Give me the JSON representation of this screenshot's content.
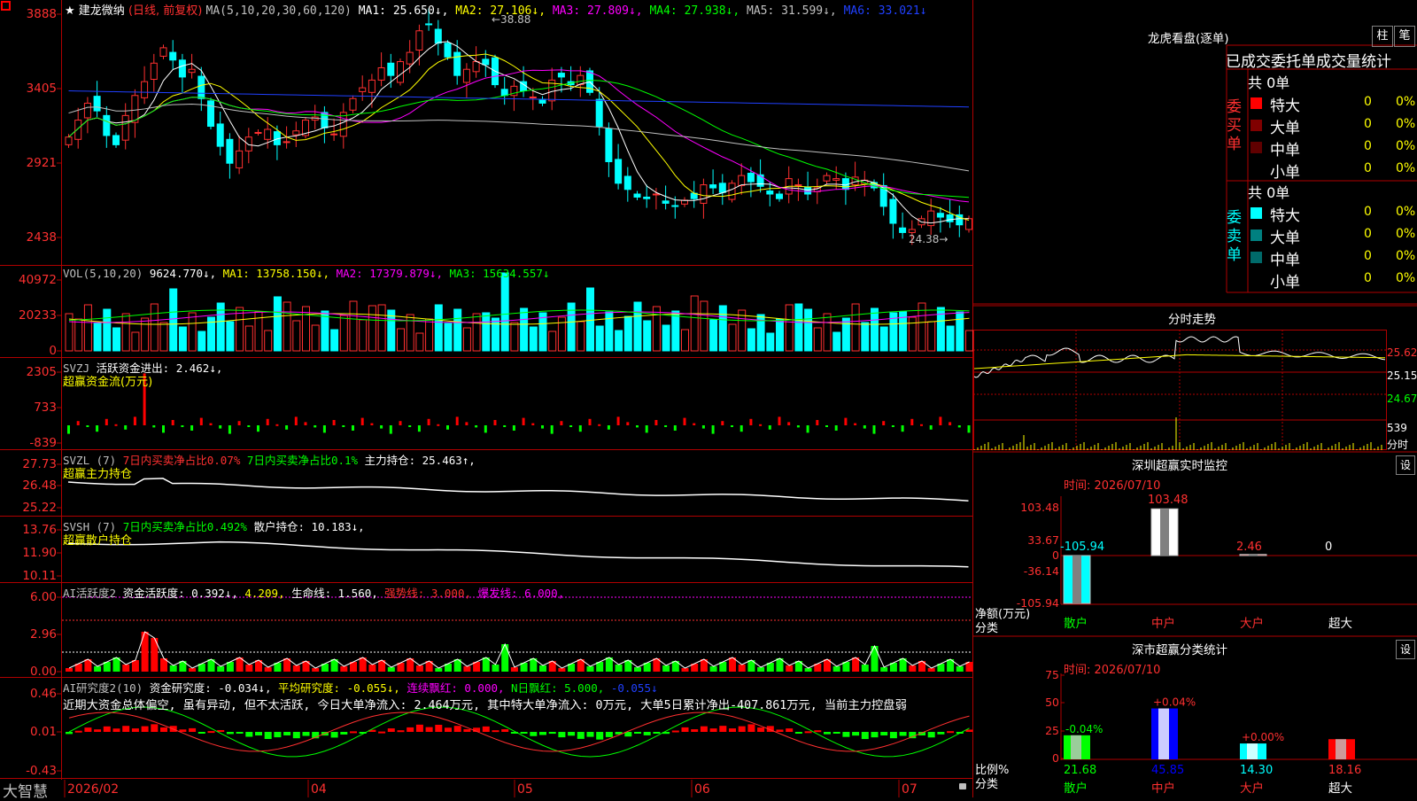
{
  "stock": {
    "name": "建龙微纳",
    "mode": "(日线, 前复权)",
    "ma_line": [
      {
        "t": "MA(5,10,20,30,60,120)",
        "c": "#c0c0c0"
      },
      {
        "t": "MA1: 25.650↓,",
        "c": "#ffffff"
      },
      {
        "t": "MA2: 27.106↓,",
        "c": "#ffff00"
      },
      {
        "t": "MA3: 27.809↓,",
        "c": "#ff00ff"
      },
      {
        "t": "MA4: 27.938↓,",
        "c": "#00ff00"
      },
      {
        "t": "MA5: 31.599↓,",
        "c": "#c0c0c0"
      },
      {
        "t": "MA6: 33.021↓",
        "c": "#2040ff"
      }
    ],
    "price_axis": [
      "3888",
      "3405",
      "2921",
      "2438"
    ],
    "high_label": "38.88",
    "low_label": "24.38"
  },
  "panels": {
    "vol": {
      "axis": [
        "40972",
        "20233",
        "0"
      ],
      "legend": [
        {
          "t": "VOL(5,10,20)",
          "c": "#c0c0c0"
        },
        {
          "t": "9624.770↓,",
          "c": "#ffffff"
        },
        {
          "t": "MA1: 13758.150↓,",
          "c": "#ffff00"
        },
        {
          "t": "MA2: 17379.879↓,",
          "c": "#ff00ff"
        },
        {
          "t": "MA3: 15634.557↓",
          "c": "#00ff00"
        }
      ]
    },
    "svzj": {
      "axis": [
        "2305",
        "733",
        "-839"
      ],
      "legend": [
        {
          "t": "SVZJ",
          "c": "#c0c0c0"
        },
        {
          "t": "活跃资金进出: 2.462↓,",
          "c": "#ffffff"
        }
      ],
      "sub": "超赢资金流(万元)"
    },
    "svzl": {
      "axis": [
        "27.73",
        "26.48",
        "25.22"
      ],
      "legend": [
        {
          "t": "SVZL (7)",
          "c": "#c0c0c0"
        },
        {
          "t": "7日内买卖净占比0.07%",
          "c": "#ff3030"
        },
        {
          "t": "7日内买卖净占比0.1%",
          "c": "#00ff00"
        },
        {
          "t": "主力持仓: 25.463↑,",
          "c": "#ffffff"
        }
      ],
      "sub": "超赢主力持仓"
    },
    "svsh": {
      "axis": [
        "13.76",
        "11.90",
        "10.11"
      ],
      "legend": [
        {
          "t": "SVSH (7)",
          "c": "#c0c0c0"
        },
        {
          "t": "7日内买卖净占比0.492%",
          "c": "#00ff00"
        },
        {
          "t": "散户持仓: 10.183↓,",
          "c": "#ffffff"
        }
      ],
      "sub": "超赢散户持仓"
    },
    "ai1": {
      "axis": [
        "6.00",
        "2.96",
        "0.00"
      ],
      "legend": [
        {
          "t": "AI活跃度2",
          "c": "#c0c0c0"
        },
        {
          "t": "资金活跃度: 0.392↓,",
          "c": "#ffffff"
        },
        {
          "t": "4.209,",
          "c": "#ffff00"
        },
        {
          "t": "生命线: 1.560,",
          "c": "#ffffff"
        },
        {
          "t": "强势线: 3.000,",
          "c": "#ff3030"
        },
        {
          "t": "爆发线: 6.000,",
          "c": "#ff00ff"
        }
      ]
    },
    "ai2": {
      "axis": [
        "0.46",
        "0.01",
        "-0.43"
      ],
      "legend": [
        {
          "t": "AI研究度2(10)",
          "c": "#c0c0c0"
        },
        {
          "t": "资金研究度: -0.034↓,",
          "c": "#ffffff"
        },
        {
          "t": "平均研究度: -0.055↓,",
          "c": "#ffff00"
        },
        {
          "t": "连续飘红: 0.000,",
          "c": "#ff00ff"
        },
        {
          "t": "N日飘红: 5.000,",
          "c": "#00ff00"
        },
        {
          "t": "-0.055↓",
          "c": "#2040ff"
        }
      ],
      "summary": "近期大资金总体偏空, 虽有异动, 但不太活跃, 今日大单净流入: 2.464万元, 其中特大单净流入: 0万元, 大单5日累计净出-407.861万元, 当前主力控盘弱"
    }
  },
  "bottom": {
    "brand": "大智慧",
    "dates": [
      "2026/02",
      "04",
      "05",
      "06",
      "07"
    ]
  },
  "right": {
    "dragon": {
      "title": "龙虎看盘(逐单)",
      "btn_bar": "柱",
      "btn_trade": "笔",
      "header": "已成交委托单成交量统计",
      "buy": {
        "side": "委买单",
        "total": "共 0单",
        "rows": [
          {
            "label": "特大",
            "qty": "0",
            "pct": "0%",
            "color": "#ff0000"
          },
          {
            "label": "大单",
            "qty": "0",
            "pct": "0%",
            "color": "#800000"
          },
          {
            "label": "中单",
            "qty": "0",
            "pct": "0%",
            "color": "#600000"
          },
          {
            "label": "小单",
            "qty": "0",
            "pct": "0%",
            "color": "#000000"
          }
        ]
      },
      "sell": {
        "side": "委卖单",
        "total": "共 0单",
        "rows": [
          {
            "label": "特大",
            "qty": "0",
            "pct": "0%",
            "color": "#00ffff"
          },
          {
            "label": "大单",
            "qty": "0",
            "pct": "0%",
            "color": "#008080"
          },
          {
            "label": "中单",
            "qty": "0",
            "pct": "0%",
            "color": "#006a6a"
          },
          {
            "label": "小单",
            "qty": "0",
            "pct": "0%",
            "color": "#000000"
          }
        ]
      }
    },
    "intraday": {
      "title": "分时走势",
      "prices": [
        "25.62",
        "25.15",
        "24.67"
      ],
      "vol_label": "539",
      "vol_unit": "分时"
    },
    "monitor": {
      "title": "深圳超赢实时监控",
      "btn": "设",
      "time": "时间: 2026/07/10",
      "axis": [
        "103.48",
        "33.67",
        "0",
        "-36.14",
        "-105.94"
      ],
      "ylabel": "净额(万元)",
      "xlabel": "分类",
      "categories": [
        "散户",
        "中户",
        "大户",
        "超大"
      ],
      "values": [
        "-105.94",
        "103.48",
        "2.46",
        "0"
      ]
    },
    "classify": {
      "title": "深市超赢分类统计",
      "btn": "设",
      "time": "时间: 2026/07/10",
      "axis": [
        "75",
        "50",
        "25",
        "0"
      ],
      "ylabel": "比例%",
      "xlabel": "分类",
      "categories": [
        "散户",
        "中户",
        "大户",
        "超大"
      ],
      "values": [
        "21.68",
        "45.85",
        "14.30",
        "18.16"
      ],
      "changes": [
        "-0.04%",
        "+0.04%",
        "+0.00%",
        ""
      ]
    }
  }
}
